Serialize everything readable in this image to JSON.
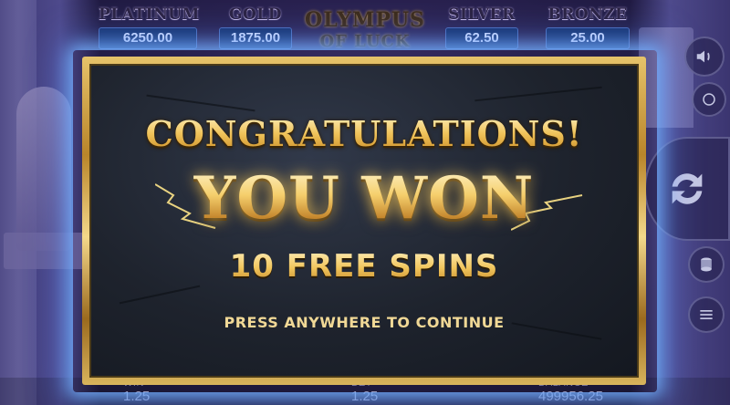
{
  "jackpots": [
    {
      "name": "PLATINUM",
      "value": "6250.00"
    },
    {
      "name": "GOLD",
      "value": "1875.00"
    },
    {
      "name": "SILVER",
      "value": "62.50"
    },
    {
      "name": "BRONZE",
      "value": "25.00"
    }
  ],
  "game_logo": {
    "line1": "OLYMPUS",
    "line2": "OF LUCK"
  },
  "modal": {
    "congrats": "CONGRATULATIONS!",
    "headline": "YOU WON",
    "prize": "10 FREE SPINS",
    "continue": "PRESS ANYWHERE TO CONTINUE"
  },
  "bottom_bar": {
    "win_label": "WIN",
    "win_value": "1.25",
    "bet_label": "BET",
    "bet_value": "1.25",
    "balance_label": "BALANCE",
    "balance_value": "499956.25"
  },
  "icons": {
    "sound": "speaker-icon",
    "turbo": "turbo-icon",
    "spin": "spin-arrows-icon",
    "coins": "coin-stack-icon",
    "menu": "hamburger-menu-icon"
  },
  "colors": {
    "gold": "#f0c35a",
    "frame_gold": "#d8b45c",
    "lightning": "#8fc0ff",
    "jackpot_box": "#15306a"
  }
}
